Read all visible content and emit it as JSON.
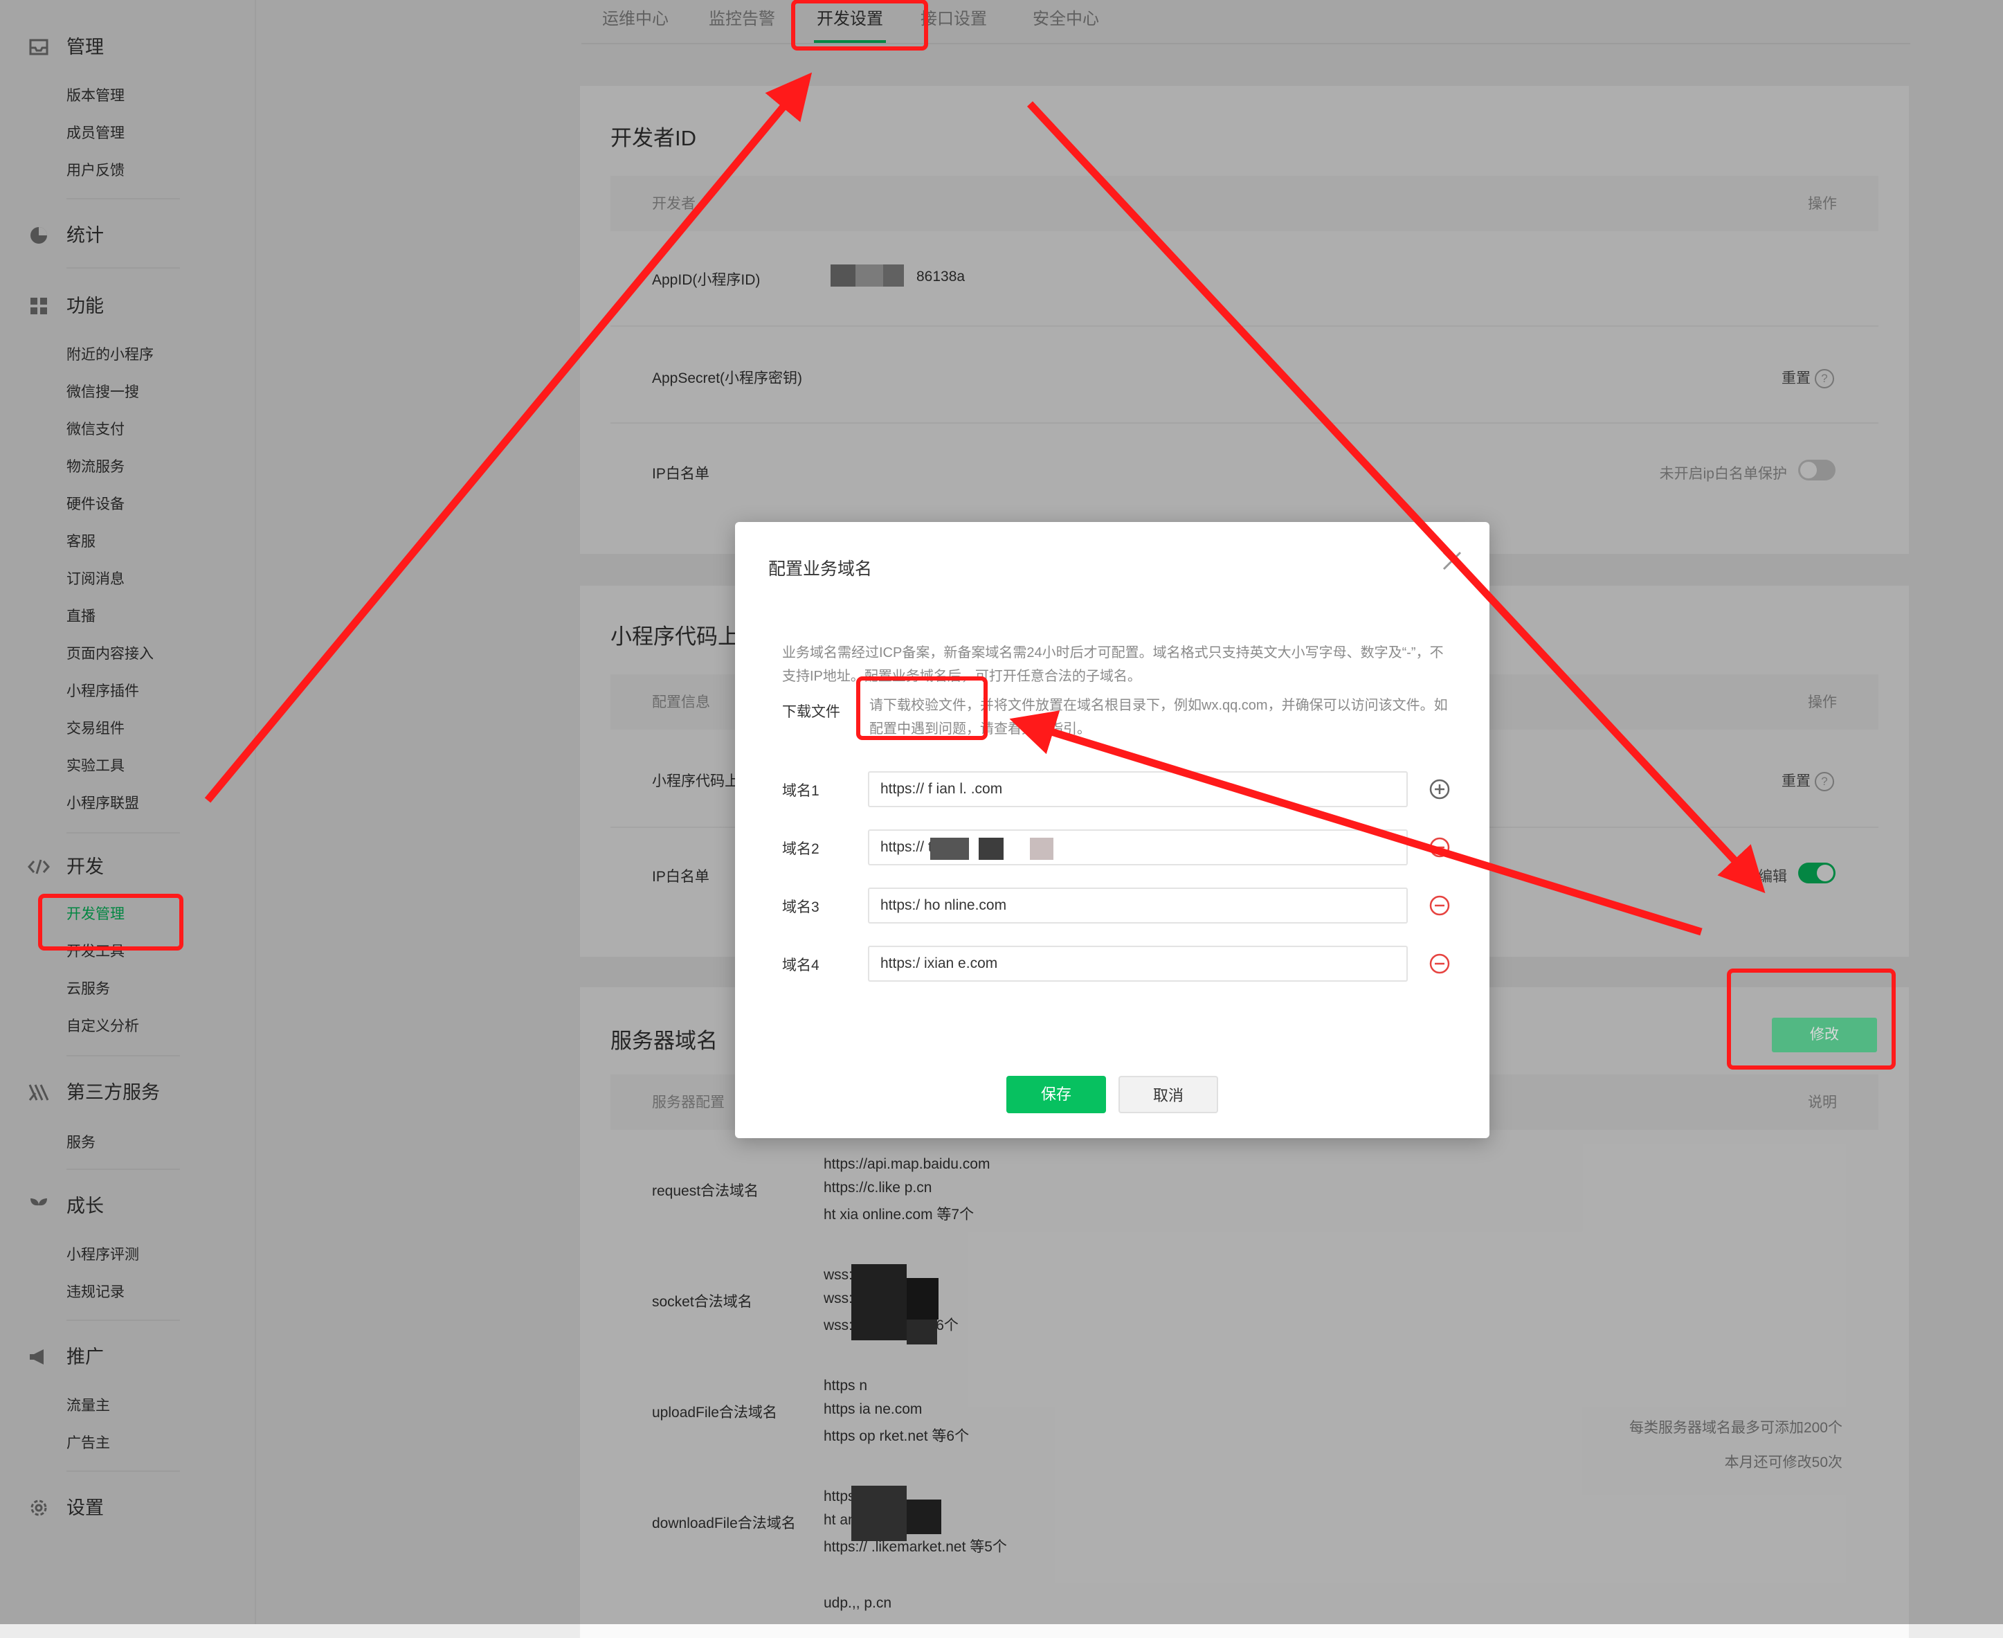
{
  "sidebar": {
    "sections": [
      {
        "title": "管理",
        "icon": "inbox-icon",
        "items": [
          "版本管理",
          "成员管理",
          "用户反馈"
        ]
      },
      {
        "title": "统计",
        "icon": "pie-chart-icon",
        "items": []
      },
      {
        "title": "功能",
        "icon": "grid-icon",
        "items": [
          "附近的小程序",
          "微信搜一搜",
          "微信支付",
          "物流服务",
          "硬件设备",
          "客服",
          "订阅消息",
          "直播",
          "页面内容接入",
          "小程序插件",
          "交易组件",
          "实验工具",
          "小程序联盟"
        ]
      },
      {
        "title": "开发",
        "icon": "code-icon",
        "items": [
          "开发管理",
          "开发工具",
          "云服务",
          "自定义分析"
        ]
      },
      {
        "title": "第三方服务",
        "icon": "third-party-icon",
        "items": [
          "服务"
        ]
      },
      {
        "title": "成长",
        "icon": "sprout-icon",
        "items": [
          "小程序评测",
          "违规记录"
        ]
      },
      {
        "title": "推广",
        "icon": "megaphone-icon",
        "items": [
          "流量主",
          "广告主"
        ]
      },
      {
        "title": "设置",
        "icon": "gear-icon",
        "items": []
      }
    ],
    "active_item": "开发管理"
  },
  "tabs": [
    "运维中心",
    "监控告警",
    "开发设置",
    "接口设置",
    "安全中心"
  ],
  "active_tab": "开发设置",
  "developer_id": {
    "title": "开发者ID",
    "col_left": "开发者",
    "col_op": "操作",
    "rows": [
      {
        "label": "AppID(小程序ID)",
        "value": "86138a",
        "op": ""
      },
      {
        "label": "AppSecret(小程序密钥)",
        "value": "",
        "op": "重置"
      },
      {
        "label": "IP白名单",
        "value": "",
        "op": "未开启ip白名单保护"
      }
    ]
  },
  "code_upload": {
    "title": "小程序代码上",
    "col_left": "配置信息",
    "col_op": "操作",
    "rows": [
      {
        "label": "小程序代码上",
        "op": "重置"
      },
      {
        "label": "IP白名单",
        "op": "编辑"
      }
    ]
  },
  "server_domain": {
    "title": "服务器域名",
    "modify": "修改",
    "col_left": "服务器配置",
    "col_right": "说明",
    "rows": [
      {
        "label": "request合法域名",
        "lines": [
          "https://api.map.baidu.com",
          "https://c.like  p.cn",
          "ht    xia  online.com 等7个"
        ]
      },
      {
        "label": "socket合法域名",
        "lines": [
          "wss:          n",
          "wss:       g    ne.com",
          "wss:     e    rket.net 等6个"
        ]
      },
      {
        "label": "uploadFile合法域名",
        "lines": [
          "https            n",
          "https       ia     ne.com",
          "https       op       rket.net 等6个"
        ]
      },
      {
        "label": "downloadFile合法域名",
        "lines": [
          "https      kesh   n",
          "ht         ang    ine.com",
          "https://       .likemarket.net 等5个"
        ]
      }
    ],
    "note1": "每类服务器域名最多可添加200个",
    "note2": "本月还可修改50次",
    "tail": "udp.,,       p.cn"
  },
  "modal": {
    "title": "配置业务域名",
    "desc": "业务域名需经过ICP备案，新备案域名需24小时后才可配置。域名格式只支持英文大小写字母、数字及“-”，不支持IP地址。配置业务域名后，可打开任意合法的子域名。",
    "download_label": "下载文件",
    "download_text": "请下载校验文件，并将文件放置在域名根目录下，例如wx.qq.com，并确保可以访问该文件。如配置中遇到问题，请查看具体指引。",
    "fields": [
      {
        "label": "域名1",
        "value": "https:// f       ian       l.  .com"
      },
      {
        "label": "域名2",
        "value": "https://                           t.net"
      },
      {
        "label": "域名3",
        "value": "https:/      ho              nline.com"
      },
      {
        "label": "域名4",
        "value": "https:/      ixian           e.com"
      }
    ],
    "save": "保存",
    "cancel": "取消"
  },
  "colors": {
    "accent": "#07c160",
    "annotation": "#ff1a1a",
    "danger": "#e64340"
  }
}
